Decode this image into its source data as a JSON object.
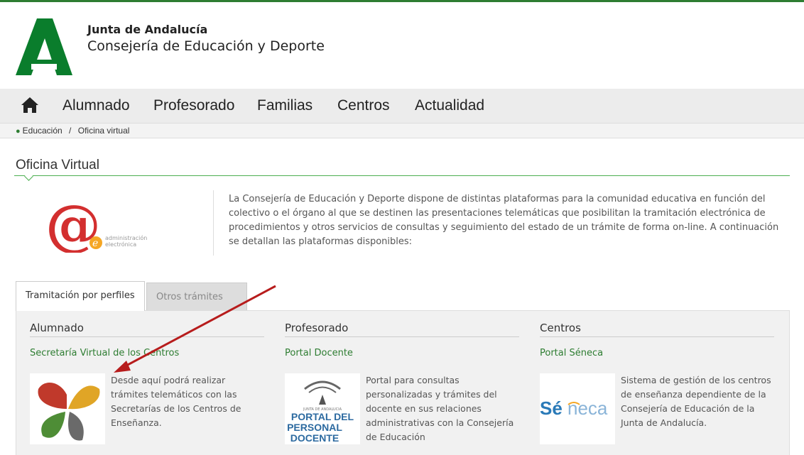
{
  "header": {
    "org_name": "Junta de Andalucía",
    "department": "Consejería de Educación y Deporte",
    "brand_color": "#2e7d32"
  },
  "nav": {
    "home_icon": "home-icon",
    "items": [
      "Alumnado",
      "Profesorado",
      "Familias",
      "Centros",
      "Actualidad"
    ]
  },
  "breadcrumb": {
    "icon": "map-marker-icon",
    "items": [
      "Educación",
      "Oficina virtual"
    ],
    "separator": "/"
  },
  "page": {
    "title": "Oficina Virtual",
    "intro": "La Consejería de Educación y Deporte dispone de distintas plataformas para la comunidad educativa en función del colectivo o el órgano al que se destinen las presentaciones telemáticas que posibilitan la tramitación electrónica de procedimientos y otros servicios de consultas y seguimiento del estado de un trámite de forma on-line. A continuación se detallan las plataformas disponibles:"
  },
  "elogo": {
    "line1": "administración",
    "line2": "electrónica"
  },
  "tabs": [
    {
      "label": "Tramitación por perfiles",
      "active": true
    },
    {
      "label": "Otros trámites",
      "active": false
    }
  ],
  "columns": [
    {
      "heading": "Alumnado",
      "link": "Secretaría Virtual de los Centros",
      "description": "Desde aquí podrá realizar trámites telemáticos con las Secretarías de los Centros de Enseñanza."
    },
    {
      "heading": "Profesorado",
      "link": "Portal Docente",
      "description": "Portal para consultas personalizadas y trámites del docente en sus relaciones administrativas con la Consejería de Educación",
      "image_text": {
        "small": "JUNTA DE ANDALUCIA",
        "l1": "PORTAL DEL",
        "l2": "PERSONAL",
        "l3": "DOCENTE"
      }
    },
    {
      "heading": "Centros",
      "link": "Portal Séneca",
      "description": "Sistema de gestión de los centros de enseñanza dependiente de la Consejería de Educación de la Junta de Andalucía.",
      "image_text": {
        "brand_a": "Sé",
        "brand_b": "neca"
      }
    }
  ]
}
